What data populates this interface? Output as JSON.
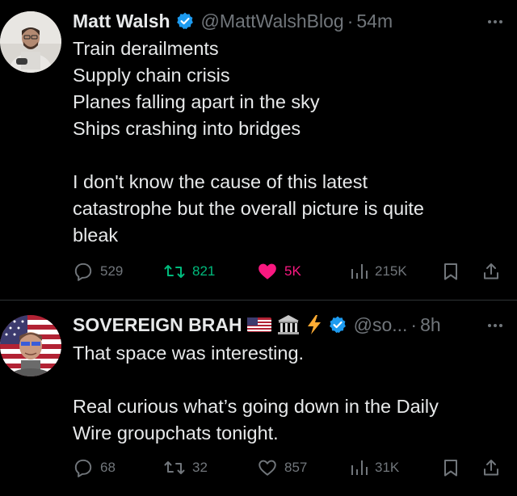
{
  "colors": {
    "background": "#000000",
    "text_primary": "#e7e9ea",
    "text_secondary": "#71767b",
    "verified_blue": "#1d9bf0",
    "retweet_green": "#00ba7c",
    "like_pink": "#f91880",
    "divider": "#2f3336"
  },
  "tweets": [
    {
      "display_name": "Matt Walsh",
      "handle": "@MattWalshBlog",
      "separator": "·",
      "time": "54m",
      "verified": true,
      "body_lines": [
        "Train derailments",
        "Supply chain crisis",
        "Planes falling apart in the sky",
        "Ships crashing into bridges",
        "",
        "I don't know the cause of this latest",
        "catastrophe but the overall picture is quite",
        "bleak"
      ],
      "replies": "529",
      "retweets": "821",
      "likes": "5K",
      "views": "215K",
      "retweeted": true,
      "liked": true
    },
    {
      "display_name": "SOVEREIGN BRAH",
      "name_emojis": [
        "us-flag-emoji",
        "classical-building-emoji",
        "lightning-emoji"
      ],
      "handle": "@so...",
      "separator": "·",
      "time": "8h",
      "verified": true,
      "body_lines": [
        "That space was interesting.",
        "",
        "Real curious what’s going down in the Daily",
        "Wire groupchats tonight."
      ],
      "replies": "68",
      "retweets": "32",
      "likes": "857",
      "views": "31K",
      "retweeted": false,
      "liked": false
    }
  ]
}
